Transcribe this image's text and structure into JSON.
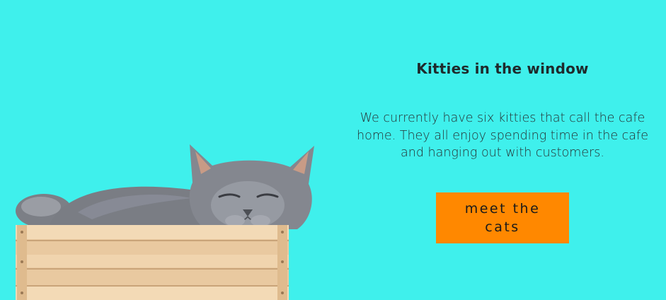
{
  "hero": {
    "heading": "Kitties in the window",
    "description": "We currently have six kitties that call the cafe home. They all enjoy spending time in the cafe and hanging out with customers.",
    "cta_label": "meet the cats"
  },
  "image": {
    "subject": "grey-cat-in-wooden-crate"
  },
  "colors": {
    "background": "#3ff0ec",
    "button": "#ff8800",
    "text": "#1f2a2c"
  }
}
